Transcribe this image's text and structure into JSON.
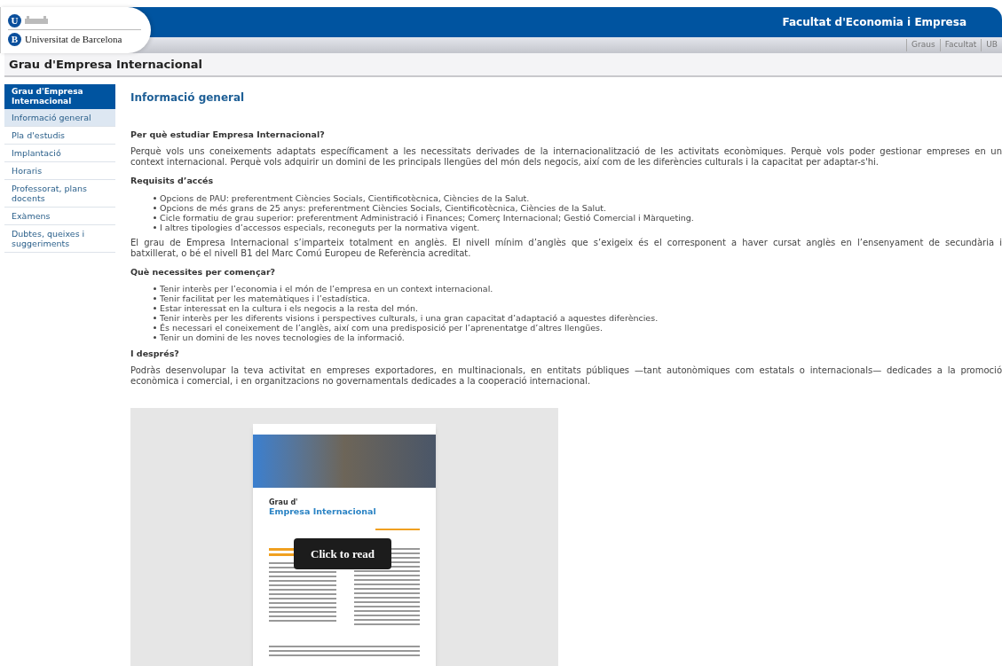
{
  "header": {
    "university": "Universitat de Barcelona",
    "logo_letters": [
      "U",
      "B"
    ],
    "faculty": "Facultat d'Economia i Empresa",
    "links": [
      "Graus",
      "Facultat",
      "UB"
    ]
  },
  "page_title": "Grau d'Empresa Internacional",
  "sidebar": {
    "heading": "Grau d'Empresa Internacional",
    "items": [
      {
        "label": "Informació general",
        "selected": true
      },
      {
        "label": "Pla d'estudis",
        "selected": false
      },
      {
        "label": "Implantació",
        "selected": false
      },
      {
        "label": "Horaris",
        "selected": false
      },
      {
        "label": "Professorat, plans docents",
        "selected": false
      },
      {
        "label": "Exàmens",
        "selected": false
      },
      {
        "label": "Dubtes, queixes i suggeriments",
        "selected": false
      }
    ]
  },
  "main": {
    "title": "Informació general",
    "sections": [
      {
        "heading": "Per què estudiar Empresa Internacional?",
        "paragraph": [
          "Perquè vols uns coneixements adaptats específicament a les necessitats derivades de la internacionalització de les activitats econòmiques. Perquè vols poder gestionar empreses en un",
          "context internacional. Perquè vols adquirir un domini  de les principals llengües del món dels negocis, així com de les diferències culturals i la capacitat per adaptar-s'hi."
        ]
      },
      {
        "heading": "Requisits d’accés",
        "bullets": [
          "Opcions de PAU: preferentment Ciències Socials, Cientificotècnica, Ciències de la Salut.",
          "Opcions de més grans de 25 anys: preferentment Ciències Socials, Cientificotècnica, Ciències de la Salut.",
          "Cicle formatiu de grau superior: preferentment Administració i Finances; Comerç Internacional; Gestió Comercial i Màrqueting.",
          "I altres tipologies d’accessos especials, reconeguts per la normativa vigent."
        ],
        "paragraph": [
          "El grau de Empresa Internacional s’imparteix totalment en anglès. El nivell mínim d’anglès que s’exigeix és el corresponent a haver cursat anglès en l’ensenyament de secundària i",
          "batxillerat, o bé el nivell B1 del Marc Comú Europeu de Referència acreditat."
        ]
      },
      {
        "heading": "Què necessites per començar?",
        "bullets": [
          "Tenir interès per l’economia i el món de l’empresa en un context internacional.",
          "Tenir facilitat per les matemàtiques i l’estadística.",
          "Estar interessat en la cultura i els negocis a la resta del món.",
          "Tenir interès per les diferents visions i perspectives culturals, i una gran capacitat d’adaptació a aquestes diferències.",
          "És necessari el coneixement de l’anglès, així com una predisposició per l’aprenentatge d’altres llengües.",
          "Tenir un domini de les noves tecnologies de la informació."
        ]
      },
      {
        "heading": "I després?",
        "paragraph": [
          "Podràs desenvolupar la teva activitat en empreses exportadores, en multinacionals, en entitats públiques —tant autonòmiques com estatals o internacionals— dedicades a la promoció",
          "econòmica i comercial, i en organitzacions no governamentals dedicades a la cooperació internacional."
        ]
      }
    ]
  },
  "brochure": {
    "title_small": "Grau d'",
    "title_large": "Empresa Internacional",
    "overlay_button": "Click to read"
  }
}
